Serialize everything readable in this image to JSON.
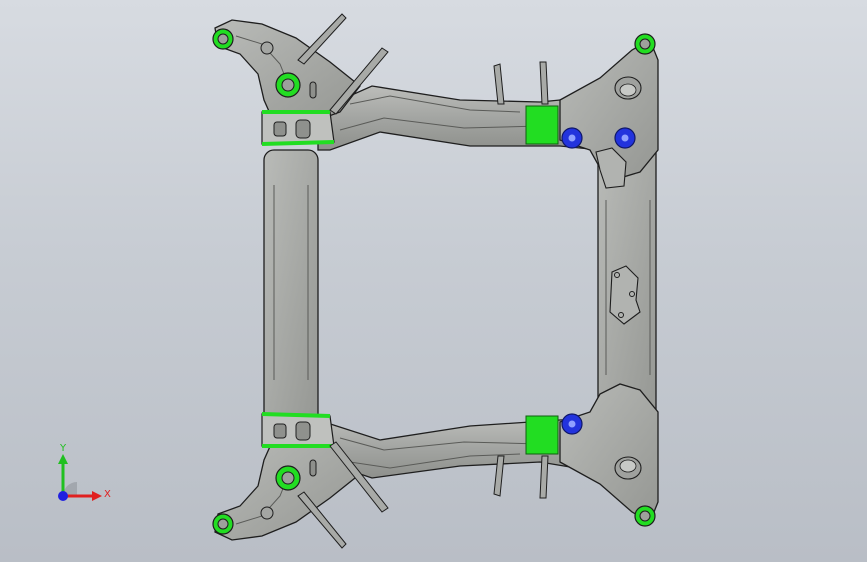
{
  "viewport": {
    "background_top": "#d7dbe1",
    "background_bottom": "#b9bec6"
  },
  "model": {
    "body_color": "#a7a9a7",
    "edge_color": "#1e1e1e",
    "mount_green": "#22dd22",
    "bushing_blue": "#2233dd"
  },
  "triad": {
    "x_label": "X",
    "y_label": "Y",
    "x_color": "#e02020",
    "y_color": "#20c020",
    "z_color": "#2020e0"
  }
}
